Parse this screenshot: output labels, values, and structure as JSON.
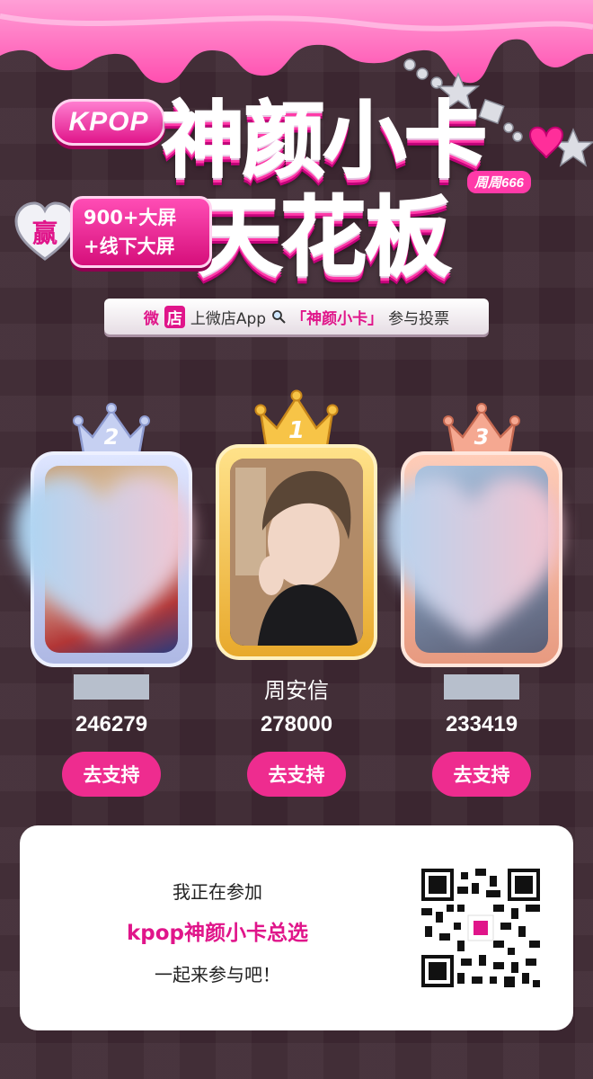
{
  "header": {
    "kpop_badge": "KPOP",
    "title_line1": "神颜小卡",
    "title_line2": "天花板",
    "week_tag": "周周666",
    "win_char": "赢",
    "win_line1": "900+大屏",
    "win_line2": "+线下大屏"
  },
  "banner": {
    "wd_a": "微",
    "wd_b": "店",
    "text_before": "上微店App",
    "search_icon": "search-icon",
    "keyword": "「神颜小卡」",
    "text_after": "参与投票"
  },
  "colors": {
    "accent": "#ee2c8f",
    "background": "#3b2630",
    "silver": "#b8c4e8",
    "gold": "#f3b83a",
    "bronze": "#f2a08a"
  },
  "candidates": [
    {
      "rank": "2",
      "name": "",
      "votes": "246279",
      "button": "去支持",
      "hidden": true
    },
    {
      "rank": "1",
      "name": "周安信",
      "votes": "278000",
      "button": "去支持",
      "hidden": false
    },
    {
      "rank": "3",
      "name": "",
      "votes": "233419",
      "button": "去支持",
      "hidden": true
    }
  ],
  "invite": {
    "line1": "我正在参加",
    "line2": "kpop神颜小卡总选",
    "line3": "一起来参与吧！",
    "qr_icon": "qr-code-icon"
  }
}
